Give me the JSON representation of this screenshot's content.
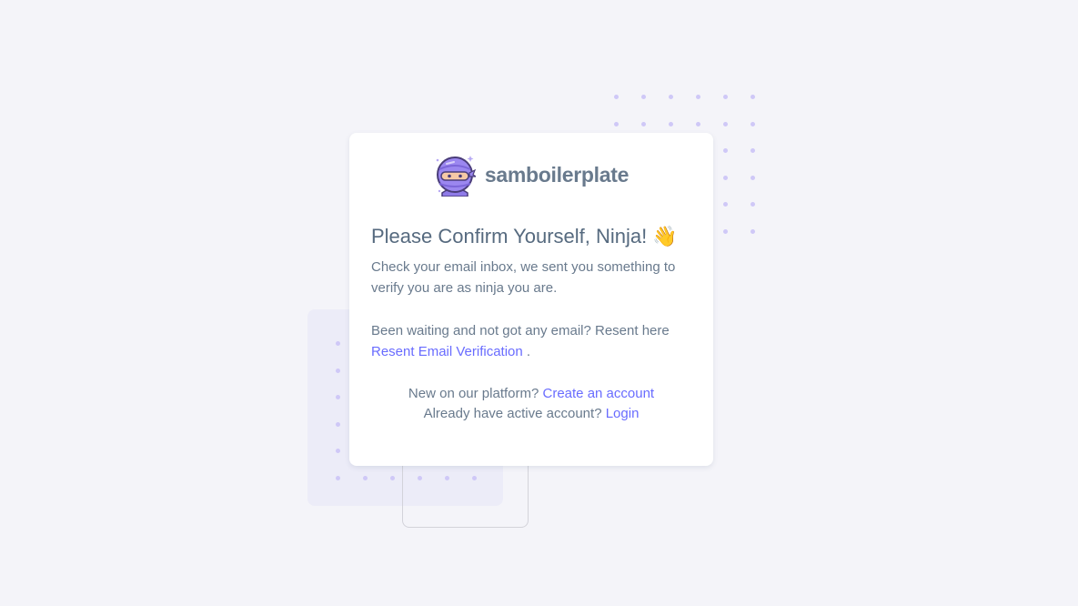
{
  "brand": {
    "name": "samboilerplate",
    "logo_icon": "ninja-mascot-icon"
  },
  "content": {
    "title": "Please Confirm Yourself, Ninja!",
    "title_emoji": "👋",
    "message": "Check your email inbox, we sent you something to verify you are as ninja you are.",
    "resend_prompt": "Been waiting and not got any email? Resent here",
    "resend_link": "Resent Email Verification",
    "resend_suffix": " ."
  },
  "footer": {
    "new_prompt": "New on our platform?",
    "create_link": "Create an account",
    "existing_prompt": "Already have active account?",
    "login_link": "Login"
  },
  "colors": {
    "background": "#f4f4f9",
    "card": "#ffffff",
    "text": "#697a8d",
    "heading": "#566a7f",
    "accent": "#696cff",
    "dots": "#cfc8f7"
  }
}
